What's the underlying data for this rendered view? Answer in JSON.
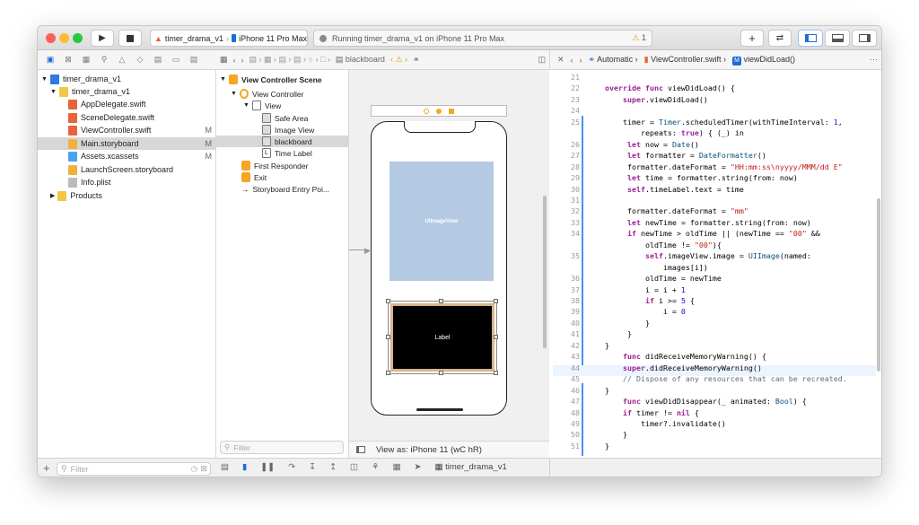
{
  "toolbar": {
    "scheme": "timer_drama_v1",
    "device": "iPhone 11 Pro Max",
    "status": "Running timer_drama_v1 on iPhone 11 Pro Max",
    "warning_count": "1"
  },
  "navigator": {
    "items": [
      {
        "label": "timer_drama_v1",
        "badge": ""
      },
      {
        "label": "timer_drama_v1",
        "badge": ""
      },
      {
        "label": "AppDelegate.swift",
        "badge": ""
      },
      {
        "label": "SceneDelegate.swift",
        "badge": ""
      },
      {
        "label": "ViewController.swift",
        "badge": "M"
      },
      {
        "label": "Main.storyboard",
        "badge": "M"
      },
      {
        "label": "Assets.xcassets",
        "badge": "M"
      },
      {
        "label": "LaunchScreen.storyboard",
        "badge": ""
      },
      {
        "label": "Info.plist",
        "badge": ""
      },
      {
        "label": "Products",
        "badge": ""
      }
    ],
    "filter_placeholder": "Filter"
  },
  "storyboard_bar": {
    "crumb": "blackboard"
  },
  "outline": {
    "items": [
      "View Controller Scene",
      "View Controller",
      "View",
      "Safe Area",
      "Image View",
      "blackboard",
      "Time Label",
      "First Responder",
      "Exit",
      "Storyboard Entry Poi..."
    ],
    "filter_placeholder": "Filter",
    "view_as": "View as: iPhone 11 (wC hR)"
  },
  "canvas": {
    "image_label": "UIImageView",
    "label_text": "Label"
  },
  "editor_bar": {
    "mode": "Automatic",
    "file": "ViewController.swift",
    "symbol": "viewDidLoad()"
  },
  "code": {
    "lines": [
      {
        "n": "21",
        "t": ""
      },
      {
        "n": "22",
        "t": "override func viewDidLoad() {"
      },
      {
        "n": "23",
        "t": "    super.viewDidLoad()"
      },
      {
        "n": "24",
        "t": ""
      },
      {
        "n": "25",
        "t": "    timer = Timer.scheduledTimer(withTimeInterval: 1,"
      },
      {
        "n": "",
        "t": "        repeats: true) { (_) in"
      },
      {
        "n": "26",
        "t": "     let now = Date()"
      },
      {
        "n": "27",
        "t": "     let formatter = DateFormatter()"
      },
      {
        "n": "28",
        "t": "     formatter.dateFormat = \"HH:mm:ss\\nyyyy/MMM/dd E\""
      },
      {
        "n": "29",
        "t": "     let time = formatter.string(from: now)"
      },
      {
        "n": "30",
        "t": "     self.timeLabel.text = time"
      },
      {
        "n": "31",
        "t": ""
      },
      {
        "n": "32",
        "t": "     formatter.dateFormat = \"mm\""
      },
      {
        "n": "33",
        "t": "     let newTime = formatter.string(from: now)"
      },
      {
        "n": "34",
        "t": "     if newTime > oldTime || (newTime == \"00\" &&"
      },
      {
        "n": "",
        "t": "         oldTime != \"00\"){"
      },
      {
        "n": "35",
        "t": "         self.imageView.image = UIImage(named:"
      },
      {
        "n": "",
        "t": "             images[i])"
      },
      {
        "n": "36",
        "t": "         oldTime = newTime"
      },
      {
        "n": "37",
        "t": "         i = i + 1"
      },
      {
        "n": "38",
        "t": "         if i >= 5 {"
      },
      {
        "n": "39",
        "t": "             i = 0"
      },
      {
        "n": "40",
        "t": "         }"
      },
      {
        "n": "41",
        "t": "     }"
      },
      {
        "n": "42",
        "t": "}"
      },
      {
        "n": "43",
        "t": "    func didReceiveMemoryWarning() {"
      },
      {
        "n": "44",
        "t": "    super.didReceiveMemoryWarning()"
      },
      {
        "n": "45",
        "t": "    // Dispose of any resources that can be recreated."
      },
      {
        "n": "46",
        "t": "}"
      },
      {
        "n": "47",
        "t": "    func viewDidDisappear(_ animated: Bool) {"
      },
      {
        "n": "48",
        "t": "    if timer != nil {"
      },
      {
        "n": "49",
        "t": "        timer?.invalidate()"
      },
      {
        "n": "50",
        "t": "    }"
      },
      {
        "n": "51",
        "t": "}"
      }
    ]
  },
  "bottom": {
    "filter_placeholder": "Filter",
    "target": "timer_drama_v1"
  }
}
